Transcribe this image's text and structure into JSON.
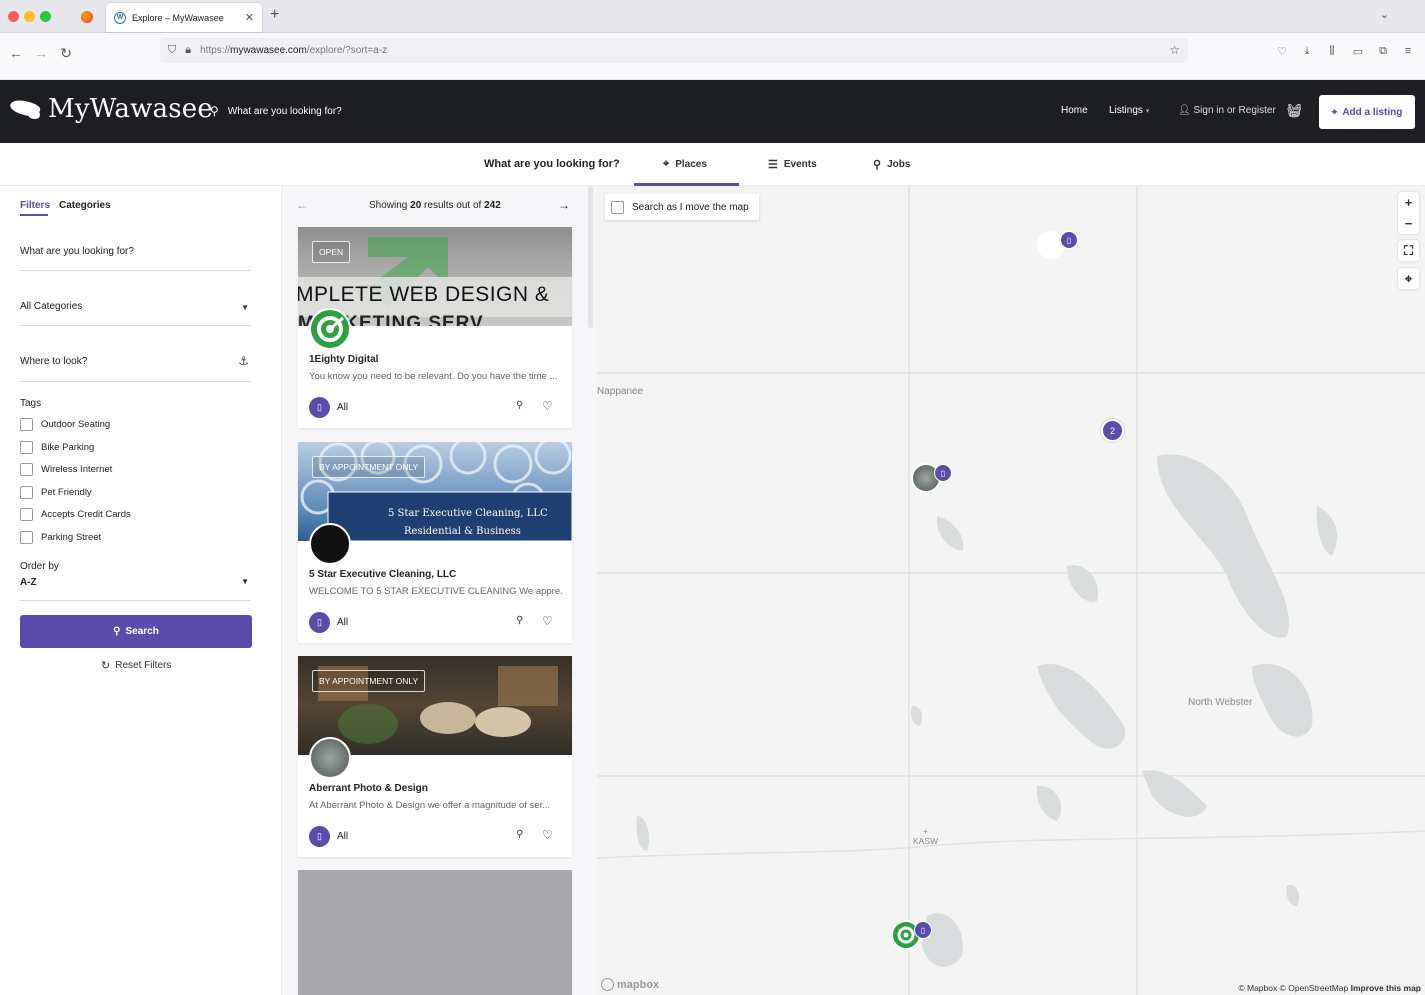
{
  "browser": {
    "tab_title": "Explore – MyWawasee",
    "url_prefix": "https://",
    "url_domain": "mywawasee.com",
    "url_path": "/explore/?sort=a-z"
  },
  "header": {
    "logo_text": "MyWawasee",
    "search_placeholder": "What are you looking for?",
    "nav_home": "Home",
    "nav_listings": "Listings",
    "sign_in": "Sign in",
    "or": "or",
    "register": "Register",
    "add_listing": "Add a listing"
  },
  "explore": {
    "label": "What are you looking for?",
    "tabs": [
      {
        "label": "Places",
        "icon": "map-pin-icon"
      },
      {
        "label": "Events",
        "icon": "list-icon"
      },
      {
        "label": "Jobs",
        "icon": "search-icon"
      }
    ]
  },
  "sidebar": {
    "tab_filters": "Filters",
    "tab_categories": "Categories",
    "keyword_placeholder": "What are you looking for?",
    "category_value": "All Categories",
    "location_placeholder": "Where to look?",
    "tags_label": "Tags",
    "tags": [
      "Outdoor Seating",
      "Bike Parking",
      "Wireless Internet",
      "Pet Friendly",
      "Accepts Credit Cards",
      "Parking Street"
    ],
    "order_label": "Order by",
    "order_value": "A-Z",
    "search_button": "Search",
    "reset_button": "Reset Filters"
  },
  "results": {
    "showing_prefix": "Showing",
    "shown": "20",
    "middle": "results out of",
    "total": "242",
    "cards": [
      {
        "badge": "OPEN",
        "banner_text": "MPLETE WEB DESIGN &",
        "banner_text2": "MARKETING SERV",
        "title": "1Eighty Digital",
        "description": "You know you need to be relevant. Do you have the time ...",
        "category": "All"
      },
      {
        "badge": "BY APPOINTMENT ONLY",
        "banner_text": "5 Star Executive Cleaning, LLC",
        "banner_text2": "Residential & Business",
        "title": "5 Star Executive Cleaning, LLC",
        "description": "WELCOME TO 5 STAR EXECUTIVE CLEANING We appre...",
        "category": "All"
      },
      {
        "badge": "BY APPOINTMENT ONLY",
        "title": "Aberrant Photo & Design",
        "description": "At Aberrant Photo & Design we offer a magnitude of ser...",
        "category": "All"
      }
    ]
  },
  "map": {
    "search_as_move": "Search as I move the map",
    "labels": [
      "Nappanee",
      "North Webster",
      "KASW"
    ],
    "cluster_count": "2",
    "mapbox_logo": "mapbox",
    "attribution": "© Mapbox © OpenStreetMap",
    "improve": "Improve this map"
  },
  "colors": {
    "accent": "#5b4bab",
    "header_bg": "#1d1e22"
  }
}
